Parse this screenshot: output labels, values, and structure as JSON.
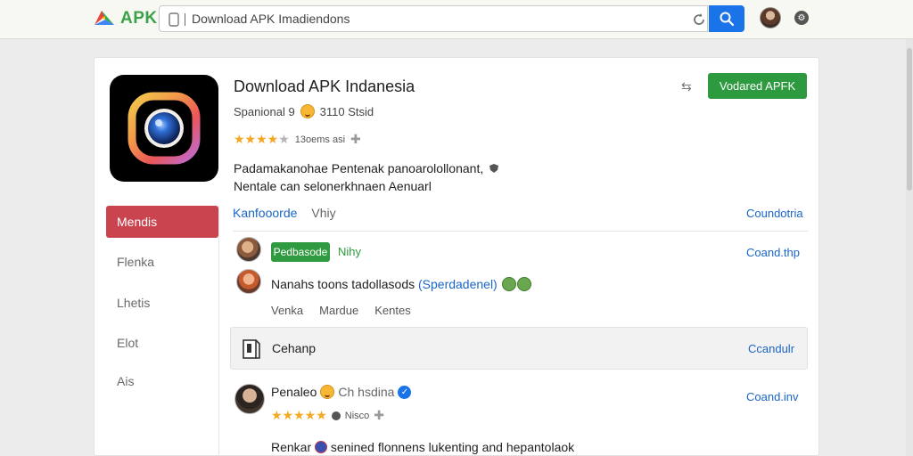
{
  "header": {
    "logo_text": "APK",
    "search_value": "Download APK Imadiendons",
    "search_placeholder": "Download APK Imadiendons"
  },
  "app": {
    "title": "Download APK Indanesia",
    "meta_left": "Spanional 9",
    "meta_right": "3110 Stsid",
    "rating_stars": 4,
    "rating_text": "13oems asi",
    "description_line1": "Padamakanohae Pentenak panoarolollonant,",
    "description_line2": "Nentale can selonerkhnaen Aenuarl",
    "primary_button": "Vodared APFK"
  },
  "sidebar": {
    "items": [
      {
        "label": "Mendis",
        "active": true
      },
      {
        "label": "Flenka",
        "active": false
      },
      {
        "label": "Lhetis",
        "active": false
      },
      {
        "label": "Elot",
        "active": false
      },
      {
        "label": "Ais",
        "active": false
      }
    ]
  },
  "main": {
    "tabs": [
      "Kanfooorde",
      "Vhiy"
    ],
    "tab_link": "Coundotria",
    "comment1": {
      "badge": "Pedbasode",
      "badge_label": "Nihy",
      "link": "Coand.thp",
      "text_pre": "Nanahs toons tadollasods",
      "text_tag": "(Sperdadenel)",
      "actions": [
        "Venka",
        "Mardue",
        "Kentes"
      ]
    },
    "highlight": {
      "text": "Cehanp",
      "link": "Ccandulr"
    },
    "comment2": {
      "name": "Penaleo",
      "handle": "Ch hsdina",
      "link": "Coand.inv",
      "stars": 5,
      "rating_text": "Nisco",
      "text_pre": "Renkar",
      "text_post": "senined flonnens lukenting and hepantolaok"
    }
  },
  "colors": {
    "accent_green": "#2e9a3f",
    "accent_red": "#c9444e",
    "link_blue": "#1a66c9",
    "search_blue": "#1a73e8"
  }
}
